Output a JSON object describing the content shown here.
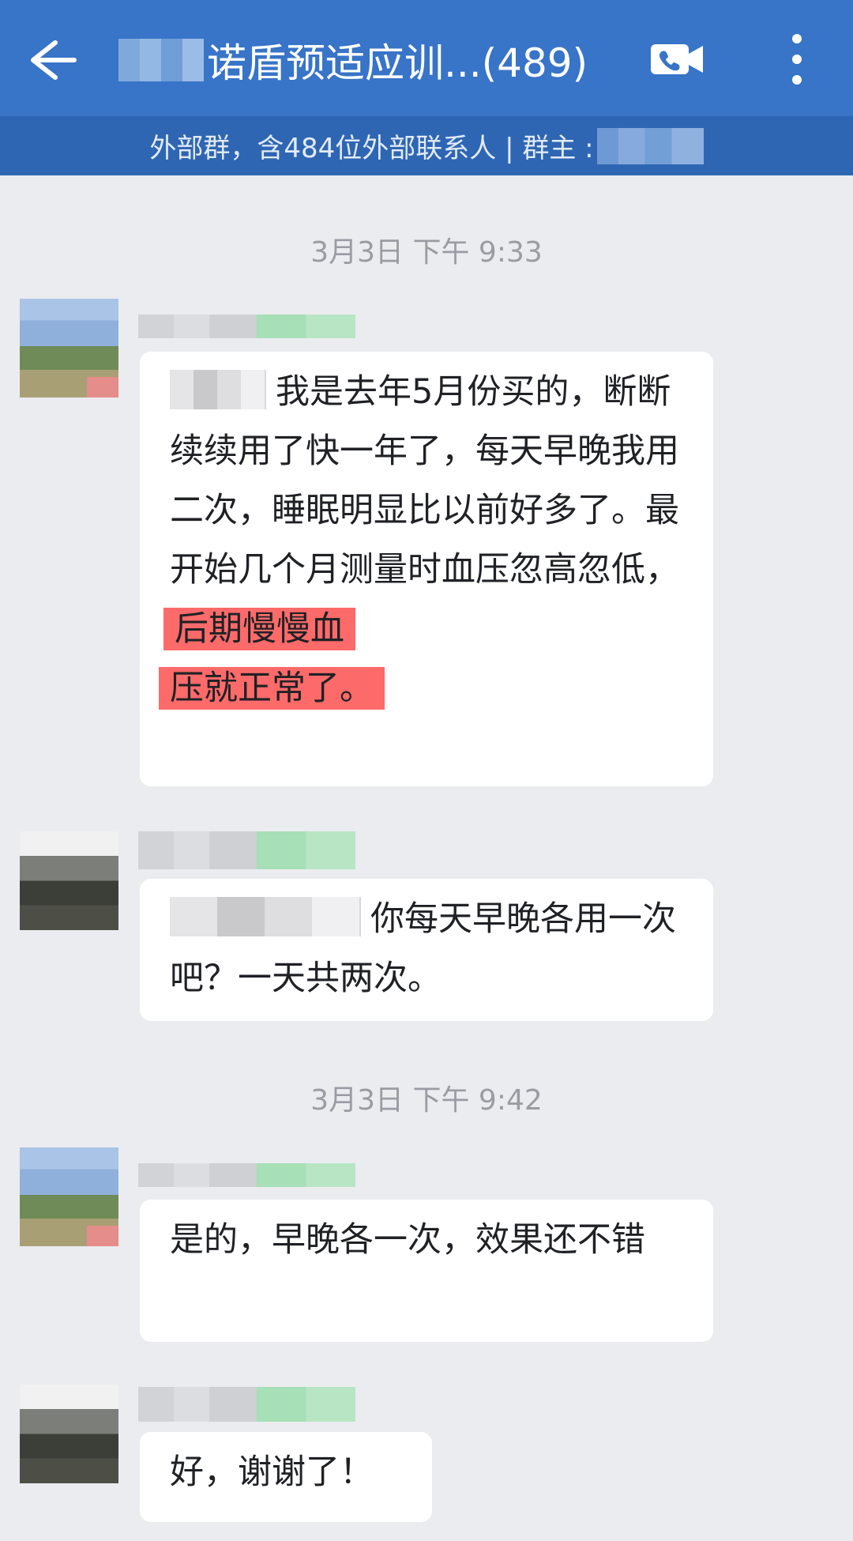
{
  "header": {
    "back_icon": "back-arrow-icon",
    "title": "诺盾预适应训...(489)",
    "video_icon": "video-call-icon",
    "more_icon": "more-vertical-icon",
    "subtitle": "外部群，含484位外部联系人 | 群主 :"
  },
  "colors": {
    "header_bg": "#3874c8",
    "subheader_bg": "#2f66b3",
    "chat_bg": "#ebecf0",
    "highlight": "#fd6a6a"
  },
  "messages": [
    {
      "timestamp": "3月3日  下午 9:33",
      "text": "我是去年5月份买的，断断续续用了快一年了，每天早晚我用二次，睡眠明显比以前好多了。最开始几个月测量时血压忽高忽低，",
      "highlight_1": "后期慢慢血",
      "highlight_2": "压就正常了。"
    },
    {
      "text": "你每天早晚各用一次吧？一天共两次。"
    },
    {
      "timestamp": "3月3日  下午 9:42",
      "text": "是的，早晚各一次，效果还不错"
    },
    {
      "text": "好，谢谢了！"
    }
  ]
}
